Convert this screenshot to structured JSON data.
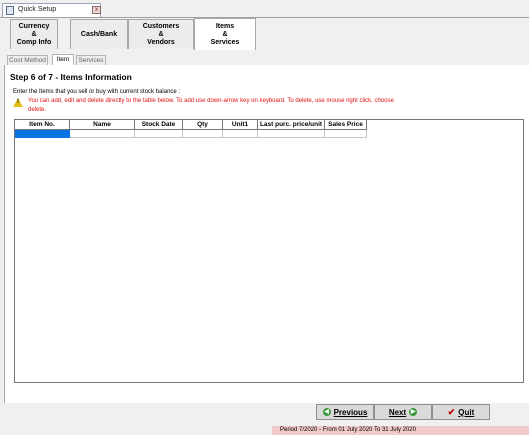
{
  "window": {
    "title": "Quick Setup",
    "close_label": "x"
  },
  "top_tabs": [
    {
      "label": "Currency\n&\nComp Info"
    },
    {
      "label": "Cash/Bank"
    },
    {
      "label": "Customers\n&\nVendors"
    },
    {
      "label": "Items\n&\nServices"
    }
  ],
  "sub_tabs": [
    {
      "label": "Cost Method"
    },
    {
      "label": "Item"
    },
    {
      "label": "Services"
    }
  ],
  "step": {
    "title": "Step 6 of 7  - Items Information",
    "instruction": "Enter the Items that you sell or buy with current stock balance :",
    "warning": "You can add, edit and delete directly to the table below. To add use down-arrow key on keyboard. To delete, use mouse right click, choose delete."
  },
  "grid": {
    "columns": [
      "Item No.",
      "Name",
      "Stock Date",
      "Qty",
      "Unit1",
      "Last purc. price/unit",
      "Sales Price"
    ]
  },
  "buttons": {
    "previous": "Previous",
    "next": "Next",
    "quit": "Quit"
  },
  "status": {
    "period": "Period 7/2020 - From 01 July 2020 To 31 July 2020"
  },
  "colors": {
    "selected_cell": "#0a74e4",
    "warning_text": "#e01010",
    "period_bg": "#f2c9c9"
  }
}
